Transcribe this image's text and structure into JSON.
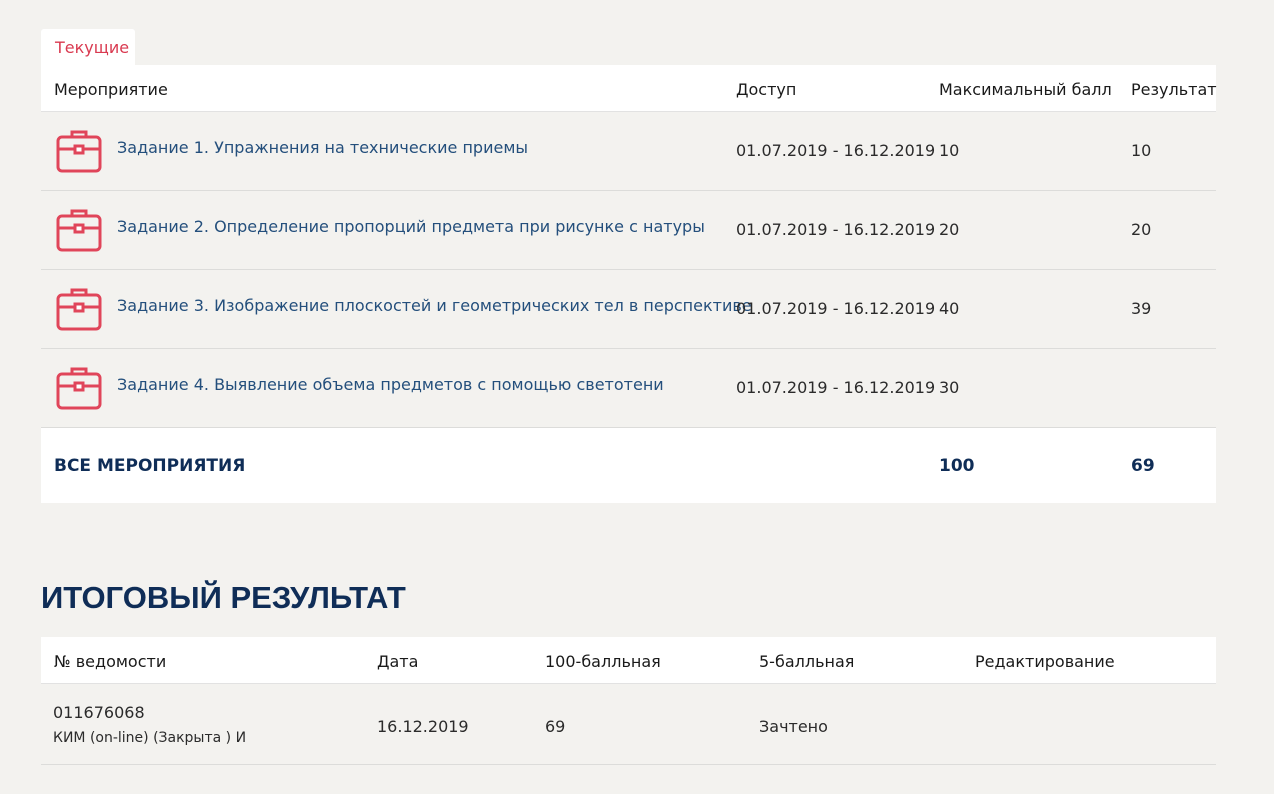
{
  "tabs": [
    {
      "label": "Текущие",
      "active": true
    }
  ],
  "events_table": {
    "headers": {
      "event": "Мероприятие",
      "access": "Доступ",
      "max_score": "Максимальный балл",
      "result": "Результат"
    },
    "rows": [
      {
        "icon": "briefcase-icon",
        "title": "Задание 1. Упражнения на технические приемы",
        "access": "01.07.2019 - 16.12.2019",
        "max_score": "10",
        "result": "10"
      },
      {
        "icon": "briefcase-icon",
        "title": "Задание 2. Определение пропорций предмета при рисунке с натуры",
        "access": "01.07.2019 - 16.12.2019",
        "max_score": "20",
        "result": "20"
      },
      {
        "icon": "briefcase-icon",
        "title": "Задание 3. Изображение плоскостей и геометрических тел в перспективе",
        "access": "01.07.2019 - 16.12.2019",
        "max_score": "40",
        "result": "39"
      },
      {
        "icon": "briefcase-icon",
        "title": "Задание 4. Выявление объема предметов с помощью светотени",
        "access": "01.07.2019 - 16.12.2019",
        "max_score": "30",
        "result": ""
      }
    ],
    "totals": {
      "label": "ВСЕ МЕРОПРИЯТИЯ",
      "max_score": "100",
      "result": "69"
    }
  },
  "final_section": {
    "title": "ИТОГОВЫЙ РЕЗУЛЬТАТ",
    "headers": {
      "sheet": "№ ведомости",
      "date": "Дата",
      "score100": "100-балльная",
      "score5": "5-балльная",
      "edit": "Редактирование"
    },
    "rows": [
      {
        "sheet": "011676068",
        "sheet_note": "КИМ (on-line) (Закрыта ) И",
        "date": "16.12.2019",
        "score100": "69",
        "score5": "Зачтено",
        "edit": ""
      }
    ]
  },
  "colors": {
    "accent": "#d93a50",
    "heading": "#0f2d57",
    "link": "#244f7c",
    "background": "#f3f2ef"
  }
}
